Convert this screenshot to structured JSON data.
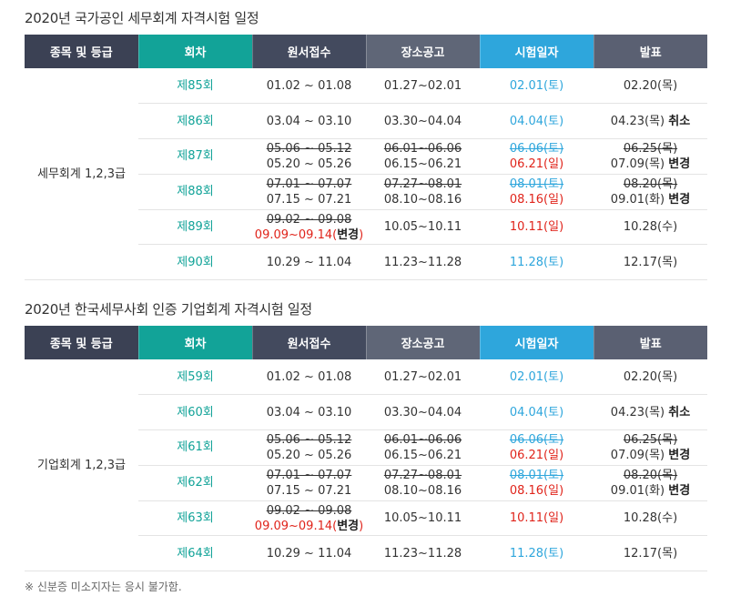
{
  "tables": [
    {
      "title": "2020년 국가공인 세무회계 자격시험 일정",
      "headers": [
        "종목 및 등급",
        "회차",
        "원서접수",
        "장소공고",
        "시험일자",
        "발표"
      ],
      "type_label": "세무회계 1,2,3급",
      "rows": [
        {
          "round": "제85회",
          "apply": [
            {
              "t": "01.02 ~ 01.08"
            }
          ],
          "place": [
            {
              "t": "01.27~02.01"
            }
          ],
          "exam": [
            {
              "t": "02.01(토)"
            }
          ],
          "result": [
            {
              "t": "02.20(목)"
            }
          ],
          "result_note": ""
        },
        {
          "round": "제86회",
          "apply": [
            {
              "t": "03.04 ~ 03.10"
            }
          ],
          "place": [
            {
              "t": "03.30~04.04"
            }
          ],
          "exam": [
            {
              "t": "04.04(토)"
            }
          ],
          "result": [
            {
              "t": "04.23(목)"
            }
          ],
          "result_note": "취소"
        },
        {
          "round": "제87회",
          "apply": [
            {
              "t": "05.06 ~ 05.12",
              "s": true
            },
            {
              "t": "05.20 ~ 05.26"
            }
          ],
          "place": [
            {
              "t": "06.01~06.06",
              "s": true
            },
            {
              "t": "06.15~06.21"
            }
          ],
          "exam": [
            {
              "t": "06.06(토)",
              "s": true
            },
            {
              "t": "06.21(일)",
              "r": true
            }
          ],
          "result": [
            {
              "t": "06.25(목)",
              "s": true
            },
            {
              "t": "07.09(목)"
            }
          ],
          "result_note": "변경"
        },
        {
          "round": "제88회",
          "apply": [
            {
              "t": "07.01 ~ 07.07",
              "s": true
            },
            {
              "t": "07.15 ~ 07.21"
            }
          ],
          "place": [
            {
              "t": "07.27~08.01",
              "s": true
            },
            {
              "t": "08.10~08.16"
            }
          ],
          "exam": [
            {
              "t": "08.01(토)",
              "s": true
            },
            {
              "t": "08.16(일)",
              "r": true
            }
          ],
          "result": [
            {
              "t": "08.20(목)",
              "s": true
            },
            {
              "t": "09.01(화)"
            }
          ],
          "result_note": "변경"
        },
        {
          "round": "제89회",
          "apply": [
            {
              "t": "09.02 ~ 09.08",
              "s": true
            },
            {
              "t": "09.09~09.14(",
              "r": true,
              "tail": "변경",
              "close": ")"
            }
          ],
          "place": [
            {
              "t": "10.05~10.11"
            }
          ],
          "exam": [
            {
              "t": "10.11(일)",
              "r": true
            }
          ],
          "result": [
            {
              "t": "10.28(수)"
            }
          ],
          "result_note": ""
        },
        {
          "round": "제90회",
          "apply": [
            {
              "t": "10.29 ~ 11.04"
            }
          ],
          "place": [
            {
              "t": "11.23~11.28"
            }
          ],
          "exam": [
            {
              "t": "11.28(토)"
            }
          ],
          "result": [
            {
              "t": "12.17(목)"
            }
          ],
          "result_note": ""
        }
      ]
    },
    {
      "title": "2020년 한국세무사회 인증 기업회계 자격시험 일정",
      "headers": [
        "종목 및 등급",
        "회차",
        "원서접수",
        "장소공고",
        "시험일자",
        "발표"
      ],
      "type_label": "기업회계 1,2,3급",
      "rows": [
        {
          "round": "제59회",
          "apply": [
            {
              "t": "01.02 ~ 01.08"
            }
          ],
          "place": [
            {
              "t": "01.27~02.01"
            }
          ],
          "exam": [
            {
              "t": "02.01(토)"
            }
          ],
          "result": [
            {
              "t": "02.20(목)"
            }
          ],
          "result_note": ""
        },
        {
          "round": "제60회",
          "apply": [
            {
              "t": "03.04 ~ 03.10"
            }
          ],
          "place": [
            {
              "t": "03.30~04.04"
            }
          ],
          "exam": [
            {
              "t": "04.04(토)"
            }
          ],
          "result": [
            {
              "t": "04.23(목)"
            }
          ],
          "result_note": "취소"
        },
        {
          "round": "제61회",
          "apply": [
            {
              "t": "05.06 ~ 05.12",
              "s": true
            },
            {
              "t": "05.20 ~ 05.26"
            }
          ],
          "place": [
            {
              "t": "06.01~06.06",
              "s": true
            },
            {
              "t": "06.15~06.21"
            }
          ],
          "exam": [
            {
              "t": "06.06(토)",
              "s": true
            },
            {
              "t": "06.21(일)",
              "r": true
            }
          ],
          "result": [
            {
              "t": "06.25(목)",
              "s": true
            },
            {
              "t": "07.09(목)"
            }
          ],
          "result_note": "변경"
        },
        {
          "round": "제62회",
          "apply": [
            {
              "t": "07.01 ~ 07.07",
              "s": true
            },
            {
              "t": "07.15 ~ 07.21"
            }
          ],
          "place": [
            {
              "t": "07.27~08.01",
              "s": true
            },
            {
              "t": "08.10~08.16"
            }
          ],
          "exam": [
            {
              "t": "08.01(토)",
              "s": true
            },
            {
              "t": "08.16(일)",
              "r": true
            }
          ],
          "result": [
            {
              "t": "08.20(목)",
              "s": true
            },
            {
              "t": "09.01(화)"
            }
          ],
          "result_note": "변경"
        },
        {
          "round": "제63회",
          "apply": [
            {
              "t": "09.02 ~ 09.08",
              "s": true
            },
            {
              "t": "09.09~09.14(",
              "r": true,
              "tail": "변경",
              "close": ")"
            }
          ],
          "place": [
            {
              "t": "10.05~10.11"
            }
          ],
          "exam": [
            {
              "t": "10.11(일)",
              "r": true
            }
          ],
          "result": [
            {
              "t": "10.28(수)"
            }
          ],
          "result_note": ""
        },
        {
          "round": "제64회",
          "apply": [
            {
              "t": "10.29 ~ 11.04"
            }
          ],
          "place": [
            {
              "t": "11.23~11.28"
            }
          ],
          "exam": [
            {
              "t": "11.28(토)"
            }
          ],
          "result": [
            {
              "t": "12.17(목)"
            }
          ],
          "result_note": ""
        }
      ]
    }
  ],
  "footnote": "※ 신분증 미소지자는 응시 불가함."
}
